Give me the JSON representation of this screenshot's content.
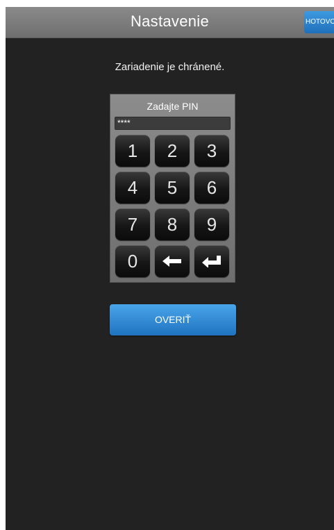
{
  "header": {
    "title": "Nastavenie",
    "done_label": "HOTOVO"
  },
  "status_text": "Zariadenie je chránené.",
  "pin_pad": {
    "label": "Zadajte PIN",
    "value": "****",
    "keys": [
      "1",
      "2",
      "3",
      "4",
      "5",
      "6",
      "7",
      "8",
      "9",
      "0"
    ],
    "backspace_icon": "left-arrow-icon",
    "enter_icon": "enter-return-icon"
  },
  "verify_label": "OVERIŤ",
  "colors": {
    "background": "#222222",
    "titlebar": "#7a7a7a",
    "accent": "#2f86d2"
  }
}
